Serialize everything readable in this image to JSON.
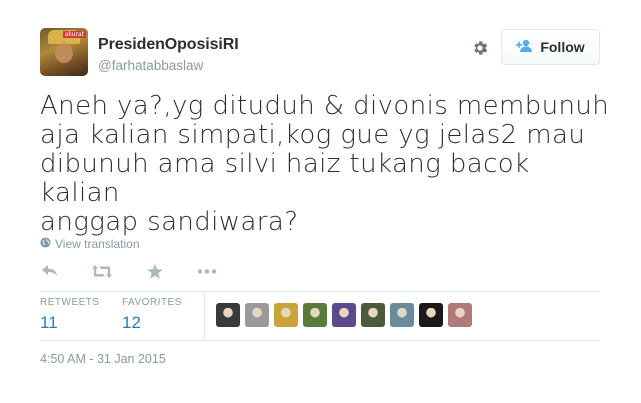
{
  "user": {
    "full_name": "PresidenOposisiRI",
    "screen_name": "@farhatabbaslaw",
    "avatar_icon": "user-avatar",
    "avatar_badge": "akurat"
  },
  "actions_header": {
    "settings_icon": "gear-icon",
    "follow_label": "Follow",
    "follow_icon": "person-add-icon"
  },
  "tweet": {
    "lines": [
      "Aneh ya?,yg dituduh & divonis membunuh",
      "aja kalian simpati,kog gue yg jelas2 mau",
      "dibunuh ama silvi haiz tukang bacok kalian",
      "anggap sandiwara?"
    ],
    "view_translation": "View translation"
  },
  "tweet_actions": [
    "reply-icon",
    "retweet-icon",
    "favorite-icon",
    "more-icon"
  ],
  "stats": {
    "retweets_label": "RETWEETS",
    "retweets_count": "11",
    "favorites_label": "FAVORITES",
    "favorites_count": "12"
  },
  "favoriters": [
    {
      "color": "#3a3a3a"
    },
    {
      "color": "#9a9a9a"
    },
    {
      "color": "#c9a43a"
    },
    {
      "color": "#5a7a3a"
    },
    {
      "color": "#5a4a8a"
    },
    {
      "color": "#4a5a3a"
    },
    {
      "color": "#6a8aa0"
    },
    {
      "color": "#1a1a1a"
    },
    {
      "color": "#b07a7a"
    }
  ],
  "timestamp": "4:50 AM - 31 Jan 2015",
  "colors": {
    "link": "#2b7bb9",
    "muted": "#8899a6",
    "text": "#292f33"
  }
}
